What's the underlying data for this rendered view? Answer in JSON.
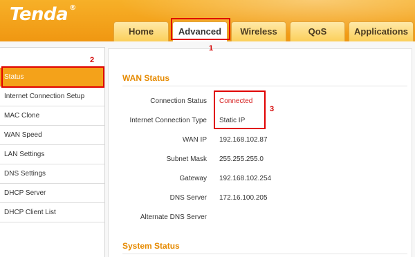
{
  "header": {
    "brand": "Tenda",
    "registered_mark": "®",
    "tabs": [
      {
        "label": "Home"
      },
      {
        "label": "Advanced"
      },
      {
        "label": "Wireless"
      },
      {
        "label": "QoS"
      },
      {
        "label": "Applications"
      }
    ]
  },
  "sidebar": {
    "items": [
      {
        "label": "Status"
      },
      {
        "label": "Internet Connection Setup"
      },
      {
        "label": "MAC Clone"
      },
      {
        "label": "WAN Speed"
      },
      {
        "label": "LAN Settings"
      },
      {
        "label": "DNS Settings"
      },
      {
        "label": "DHCP Server"
      },
      {
        "label": "DHCP Client List"
      }
    ]
  },
  "wan_status": {
    "title": "WAN Status",
    "rows": [
      {
        "label": "Connection Status",
        "value": "Connected"
      },
      {
        "label": "Internet Connection Type",
        "value": "Static IP"
      },
      {
        "label": "WAN IP",
        "value": "192.168.102.87"
      },
      {
        "label": "Subnet Mask",
        "value": "255.255.255.0"
      },
      {
        "label": "Gateway",
        "value": "192.168.102.254"
      },
      {
        "label": "DNS Server",
        "value": "172.16.100.205"
      },
      {
        "label": "Alternate DNS Server",
        "value": ""
      }
    ]
  },
  "system_status": {
    "title": "System Status"
  },
  "annotations": {
    "one": "1",
    "two": "2",
    "three": "3"
  },
  "colors": {
    "accent": "#f4a21a",
    "status_connected": "#d62020",
    "annotation": "#e00000"
  }
}
